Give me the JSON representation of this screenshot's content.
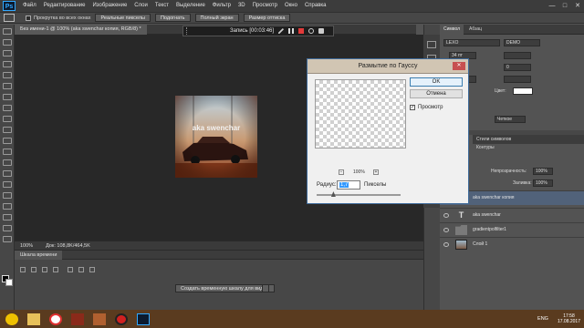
{
  "app": {
    "logo": "Ps"
  },
  "menu": {
    "items": [
      "Файл",
      "Редактирование",
      "Изображение",
      "Слои",
      "Текст",
      "Выделение",
      "Фильтр",
      "3D",
      "Просмотр",
      "Окно",
      "Справка"
    ]
  },
  "window_controls": {
    "minimize": "—",
    "maximize": "□",
    "close": "✕"
  },
  "options_bar": {
    "scroll_all_windows": "Прокрутка во всех окнах",
    "real_pixels": "Реальные пикселы",
    "fit": "Подогнать",
    "full_screen": "Полный экран",
    "print_size": "Размер оттиска"
  },
  "document": {
    "tab_title": "Без имени-1 @ 100% (aka swenchar копия, RGB/8) *",
    "zoom": "100%",
    "doc_size": "Док: 108,8K/464,5K"
  },
  "recording": {
    "label": "Запись [00:03:46]"
  },
  "timeline": {
    "tab": "Шкала времени",
    "create_button": "Создать временную шкалу для видео"
  },
  "character_panel": {
    "tabs": [
      "Символ",
      "Абзац"
    ],
    "font": "LEXO",
    "style": "DEMO",
    "tracking_value": "0",
    "color_label": "Цвет:",
    "size_value": "34 пт",
    "sharp": "Четкое",
    "sharp_short": "aa"
  },
  "layers_panel": {
    "tabs": [
      "Стили символов",
      "Контуры"
    ],
    "opacity_label": "Непрозрачность:",
    "opacity_value": "100%",
    "fill_label": "Заливка:",
    "fill_value": "100%",
    "layers": [
      {
        "name": "aka swenchar копия",
        "type": "raster",
        "selected": true
      },
      {
        "name": "aka swenchar",
        "type": "text",
        "selected": false
      },
      {
        "name": "gradientpolfilter1",
        "type": "group",
        "selected": false
      },
      {
        "name": "Слой 1",
        "type": "raster",
        "selected": false
      }
    ]
  },
  "dialog": {
    "title": "Размытие по Гауссу",
    "close": "✕",
    "ok": "OK",
    "cancel": "Отмена",
    "preview_label": "Просмотр",
    "preview_checked": true,
    "zoom_minus": "−",
    "zoom_plus": "+",
    "zoom": "100%",
    "radius_label": "Радиус:",
    "radius_value": "1,7",
    "radius_unit": "Пикселы",
    "radius_fraction": 0.2
  },
  "photo": {
    "overlay_text": "aka swenchar"
  },
  "taskbar": {
    "items": [
      "start-button",
      "explorer",
      "yandex-browser",
      "media-app",
      "media-app-2",
      "record-app",
      "photoshop"
    ],
    "lang": "ENG",
    "time": "17:58",
    "date": "17.08.2017"
  },
  "colors": {
    "accent": "#31a8ff",
    "dialog_title_bg": "#d1c5b3",
    "taskbar": "#5a3b1f",
    "selected_layer": "#51627a"
  }
}
